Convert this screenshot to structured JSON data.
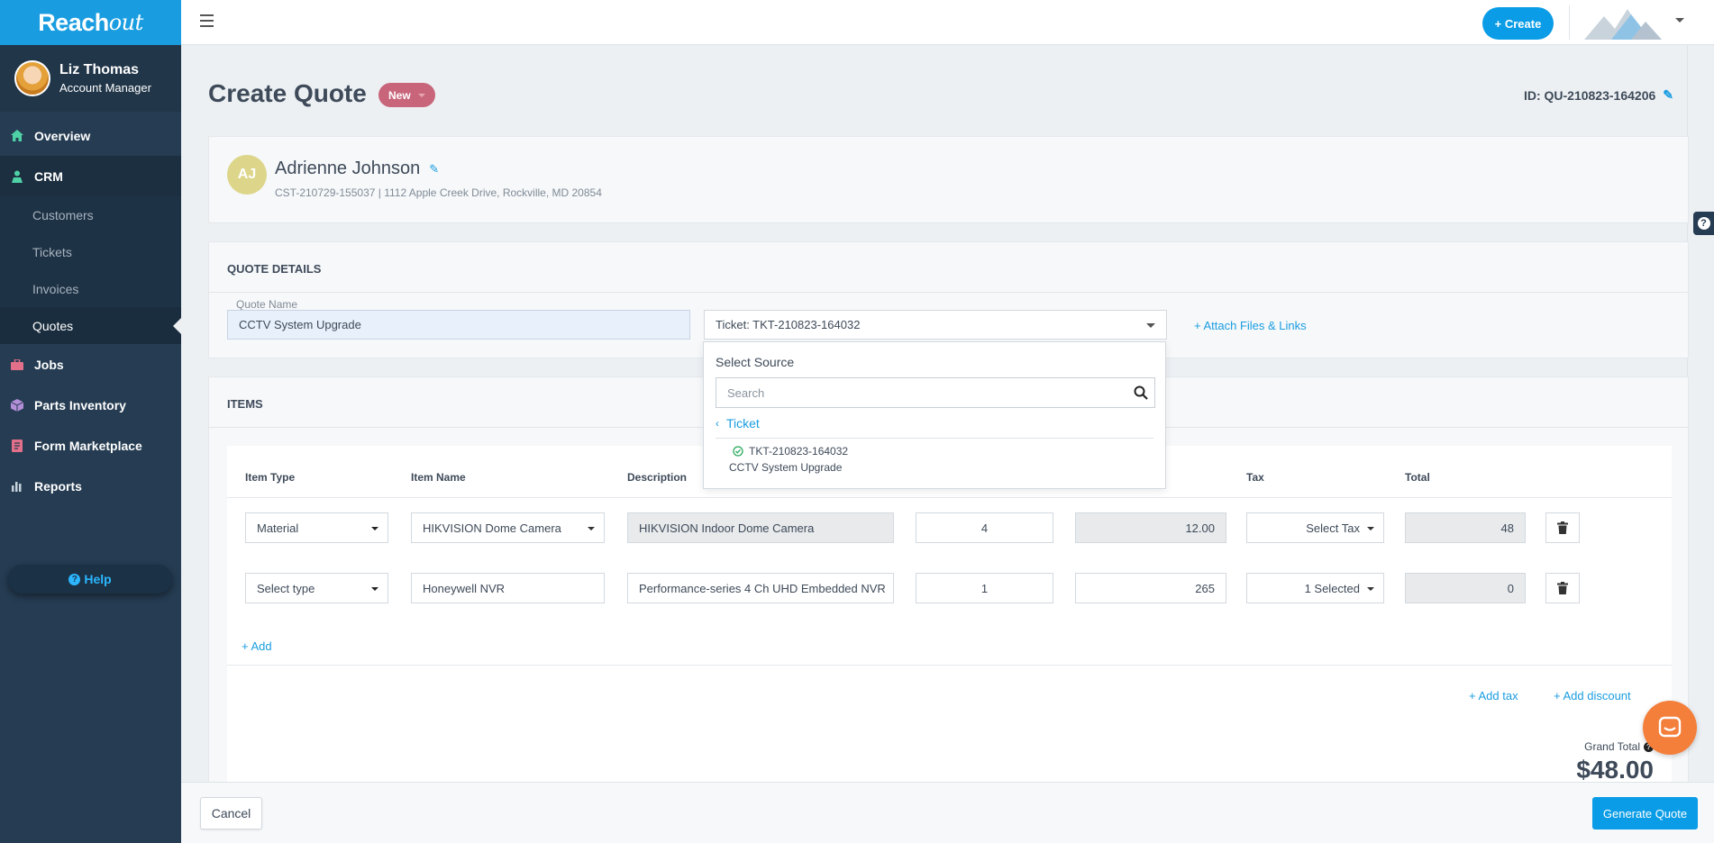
{
  "app": {
    "brand": "Reach",
    "brand_suffix": "out"
  },
  "user": {
    "name": "Liz Thomas",
    "role": "Account Manager"
  },
  "nav": {
    "overview": "Overview",
    "crm": "CRM",
    "crm_sub": [
      "Customers",
      "Tickets",
      "Invoices",
      "Quotes"
    ],
    "jobs": "Jobs",
    "parts": "Parts Inventory",
    "forms": "Form Marketplace",
    "reports": "Reports",
    "help": "Help"
  },
  "topbar": {
    "create_label": "+ Create"
  },
  "page": {
    "title": "Create Quote",
    "status": "New",
    "quote_id": "ID: QU-210823-164206"
  },
  "customer": {
    "initials": "AJ",
    "name": "Adrienne Johnson",
    "meta": "CST-210729-155037 | 1112 Apple Creek Drive, Rockville, MD 20854"
  },
  "details": {
    "section_title": "QUOTE DETAILS",
    "quote_name_label": "Quote Name",
    "quote_name_value": "CCTV System Upgrade",
    "ticket_select": "Ticket: TKT-210823-164032",
    "attach_link": "+ Attach Files & Links"
  },
  "source_menu": {
    "title": "Select Source",
    "search_placeholder": "Search",
    "back_label": "Ticket",
    "option_id": "TKT-210823-164032",
    "option_name": "CCTV System Upgrade"
  },
  "items": {
    "section_title": "ITEMS",
    "columns": {
      "item_type": "Item Type",
      "item_name": "Item Name",
      "description": "Description",
      "tax": "Tax",
      "total": "Total"
    },
    "rows": [
      {
        "type": "Material",
        "name": "HIKVISION Dome Camera",
        "description": "HIKVISION Indoor Dome Camera",
        "qty": "4",
        "price": "12.00",
        "tax": "Select Tax",
        "total": "48"
      },
      {
        "type": "Select type",
        "name": "Honeywell NVR",
        "description": "Performance-series 4 Ch UHD Embedded NVR",
        "qty": "1",
        "price": "265",
        "tax": "1 Selected",
        "total": "0"
      }
    ],
    "add_link": "+ Add",
    "add_tax": "+ Add tax",
    "add_discount": "+ Add discount",
    "grand_total_label": "Grand Total",
    "grand_total_value": "$48.00"
  },
  "footer": {
    "cancel": "Cancel",
    "generate": "Generate Quote"
  },
  "colors": {
    "accent": "#0a9ce6",
    "sidebar": "#253c52",
    "badge": "#c8657a",
    "chat": "#f47f3b"
  }
}
